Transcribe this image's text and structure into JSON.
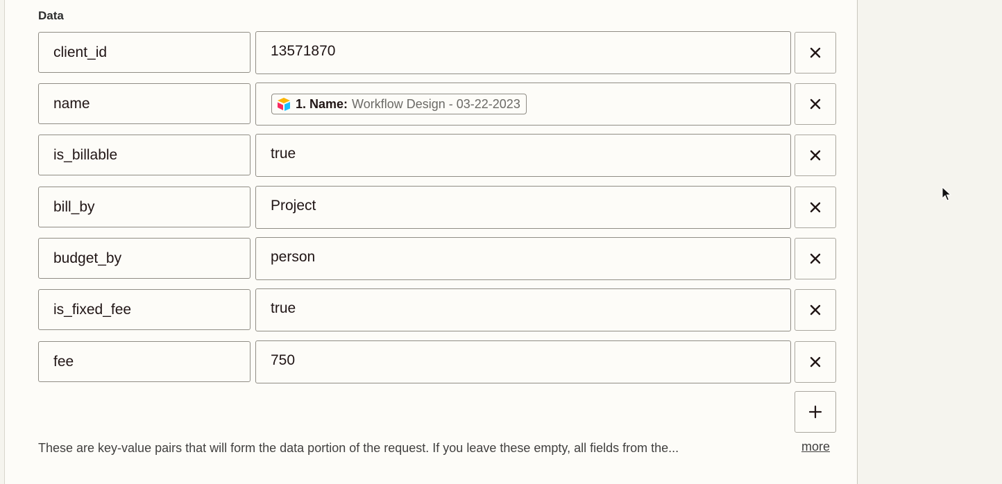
{
  "section": {
    "label": "Data"
  },
  "rows": [
    {
      "key": "client_id",
      "value": "13571870"
    },
    {
      "key": "name",
      "pill": {
        "step": "1. Name:",
        "value": "Workflow Design - 03-22-2023",
        "icon": "airtable-icon"
      }
    },
    {
      "key": "is_billable",
      "value": "true"
    },
    {
      "key": "bill_by",
      "value": "Project"
    },
    {
      "key": "budget_by",
      "value": "person"
    },
    {
      "key": "is_fixed_fee",
      "value": "true"
    },
    {
      "key": "fee",
      "value": "750"
    }
  ],
  "help": {
    "text": "These are key-value pairs that will form the data portion of the request. If you leave these empty, all fields from the...",
    "more": "more"
  },
  "icons": {
    "remove": "close-icon",
    "add": "plus-icon",
    "pointer": "mouse-cursor-icon"
  },
  "colors": {
    "panel_bg": "#fdfcf8",
    "page_bg": "#f5f4ee",
    "border": "#8f8c84",
    "text": "#201515"
  }
}
